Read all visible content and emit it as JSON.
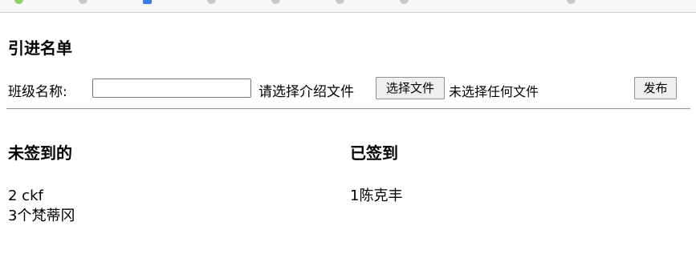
{
  "page": {
    "heading": "引进名单"
  },
  "form": {
    "class_label": "班级名称:",
    "class_input_value": "",
    "file_label": "请选择介绍文件",
    "choose_file_button": "选择文件",
    "no_file_text": "未选择任何文件",
    "publish_button": "发布"
  },
  "not_signed": {
    "title": "未签到的",
    "entries": [
      "2 ckf",
      "3个梵蒂冈"
    ]
  },
  "signed": {
    "title": "已签到",
    "entries": [
      "1陈克丰"
    ]
  }
}
